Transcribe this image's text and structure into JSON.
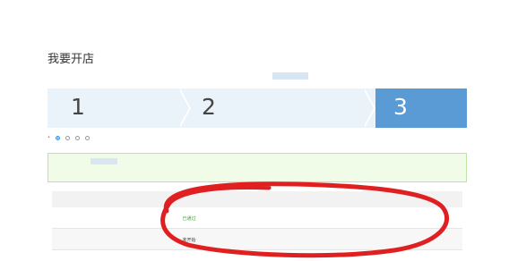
{
  "page": {
    "title": "我要开店",
    "notice": "",
    "notice_redaction_color": "#d8e6f3"
  },
  "steps": [
    {
      "number": "1",
      "title": "",
      "subtitle": "",
      "active": false
    },
    {
      "number": "2",
      "title": "",
      "subtitle": "",
      "active": false
    },
    {
      "number": "3",
      "title": "",
      "subtitle": "",
      "active": true
    }
  ],
  "colors": {
    "steps_bg": "#eaf2fa",
    "step_active": "#5b9bd5",
    "success_text": "#3aa63a",
    "link": "#3b8fdc",
    "alert_bg": "#f0fbe8",
    "alert_border": "#bde3a5",
    "annotation_stroke": "#e02020"
  },
  "user_type": {
    "label": "",
    "options": [
      {
        "label": "",
        "selected": true
      },
      {
        "label": "",
        "selected": false
      },
      {
        "label": "",
        "selected": false
      },
      {
        "label": "",
        "selected": false
      }
    ]
  },
  "alert": {
    "line1": "",
    "line2": ""
  },
  "table": {
    "headers": [
      "",
      "",
      "",
      ""
    ],
    "rows": [
      {
        "name": "",
        "status": "已通过",
        "hint": "",
        "action": ""
      },
      {
        "name": "",
        "status": "未开始",
        "hint": "",
        "action": ""
      }
    ]
  }
}
